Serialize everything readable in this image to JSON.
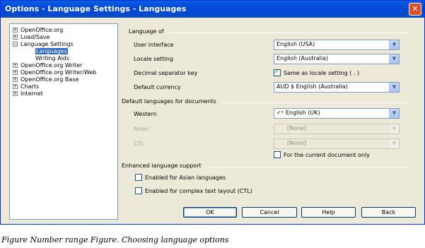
{
  "window": {
    "title": "Options - Language Settings - Languages",
    "close_glyph": "✕"
  },
  "tree": {
    "items": [
      {
        "label": "OpenOffice.org",
        "expander": "+"
      },
      {
        "label": "Load/Save",
        "expander": "+"
      },
      {
        "label": "Language Settings",
        "expander": "−"
      },
      {
        "label": "Languages",
        "expander": ""
      },
      {
        "label": "Writing Aids",
        "expander": ""
      },
      {
        "label": "OpenOffice.org Writer",
        "expander": "+"
      },
      {
        "label": "OpenOffice.org Writer/Web",
        "expander": "+"
      },
      {
        "label": "OpenOffice.org Base",
        "expander": "+"
      },
      {
        "label": "Charts",
        "expander": "+"
      },
      {
        "label": "Internet",
        "expander": "+"
      }
    ]
  },
  "language_of": {
    "heading": "Language of",
    "user_interface": {
      "label": "User interface",
      "value": "English (USA)"
    },
    "locale_setting": {
      "label": "Locale setting",
      "value": "English (Australia)"
    },
    "decimal_separator": {
      "label": "Decimal separator key",
      "checkbox_label": "Same as locale setting ( . )",
      "checked": true
    },
    "default_currency": {
      "label": "Default currency",
      "value": "AUD $ English (Australia)"
    }
  },
  "default_languages": {
    "heading": "Default languages for documents",
    "western": {
      "label": "Western",
      "value": "English (UK)",
      "icon": "spellcheck-icon"
    },
    "asian": {
      "label": "Asian",
      "value": "[None]"
    },
    "ctl": {
      "label": "CTL",
      "value": "[None]"
    },
    "current_doc_only": {
      "label": "For the current document only",
      "checked": false
    }
  },
  "enhanced": {
    "heading": "Enhanced language support",
    "asian": {
      "label": "Enabled for Asian languages",
      "checked": false
    },
    "ctl": {
      "label": "Enabled for complex text layout (CTL)",
      "checked": false
    }
  },
  "buttons": {
    "ok": "OK",
    "cancel": "Cancel",
    "help": "Help",
    "back": "Back"
  },
  "caption": "Figure Number range Figure. Choosing language options"
}
